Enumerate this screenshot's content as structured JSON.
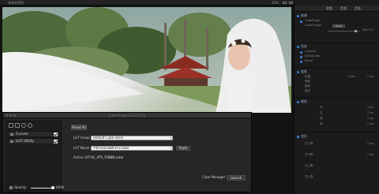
{
  "topbar": {
    "title": "未命名项目",
    "zoom": "35%"
  },
  "inspector": {
    "tabs": [
      "视频",
      "音频",
      "信息"
    ],
    "sections": [
      {
        "title": "效果",
        "rows": [
          "CubePlugin",
          "Cube Plugin",
          "Reset"
        ]
      },
      {
        "title": "色彩",
        "rows": [
          "Colorize",
          "Beauty Box",
          "Blend"
        ]
      },
      {
        "title": "变换",
        "rows": [
          "位置",
          "缩放",
          "旋转",
          "锚点"
        ]
      },
      {
        "title": "裁剪",
        "rows": [
          "左",
          "右",
          "顶",
          "底"
        ]
      },
      {
        "title": "变形",
        "rows": [
          "左下角",
          "右下角",
          "左上角",
          "右上角"
        ]
      }
    ],
    "values": [
      "100.0 %",
      "0 px",
      "0 px",
      "0 px",
      "0 px",
      "0 px",
      "0 px",
      "0 px",
      "0 px"
    ]
  },
  "plugin": {
    "title": "Cube Plugin v1.0.16 (4)",
    "sidebar": {
      "layers": [
        {
          "label": "Curves",
          "checked": true
        },
        {
          "label": "LUT Utility",
          "checked": true
        }
      ],
      "opacity_label": "Opacity",
      "opacity_value": "100%"
    },
    "main": {
      "reset_label": "Reset All",
      "lut_group_label": "LUT Group",
      "lut_group_value": "Default Cube Store",
      "lut_name_label": "LUT Name",
      "lut_name_value": "YVA-GOLDEN-D-v.cube",
      "apply_label": "Apply",
      "active_lut_label": "Active LUT:",
      "active_lut_value": "AC_ATS_YSBBB.cube",
      "cube_manager_label": "Cube Manager",
      "launch_label": "Launch"
    }
  }
}
